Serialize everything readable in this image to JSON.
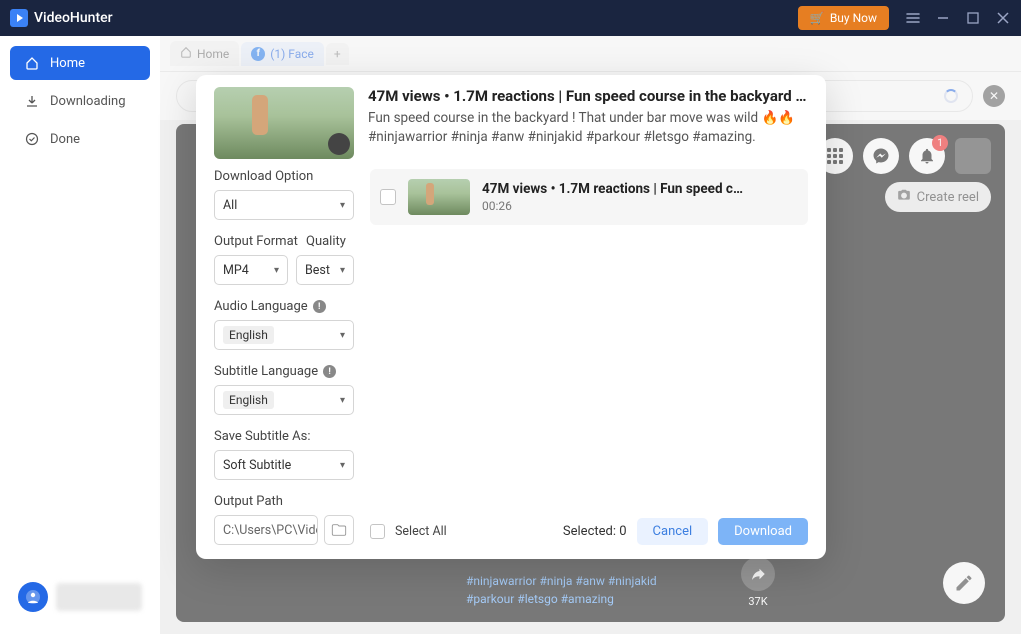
{
  "titlebar": {
    "app_name": "VideoHunter",
    "buy_label": "Buy Now"
  },
  "sidebar": {
    "items": [
      {
        "label": "Home"
      },
      {
        "label": "Downloading"
      },
      {
        "label": "Done"
      }
    ]
  },
  "tabs": {
    "home_label": "Home",
    "fb_label": "(1) Face"
  },
  "fb": {
    "create_reel": "Create reel",
    "notif_badge": "1",
    "share_count": "37K",
    "caption_line1_tags": "#ninjawarrior #ninja #anw #ninjakid",
    "caption_line2_tags": "#parkour #letsgo #amazing"
  },
  "modal": {
    "title": "47M views • 1.7M reactions | Fun speed course in the backyard ! T…",
    "description": "Fun speed course in the backyard ! That under bar move was wild 🔥🔥 #ninjawarrior #ninja #anw #ninjakid #parkour #letsgo #amazing.",
    "options": {
      "download_option_label": "Download Option",
      "download_option_value": "All",
      "output_format_label": "Output Format",
      "output_format_value": "MP4",
      "quality_label": "Quality",
      "quality_value": "Best",
      "audio_lang_label": "Audio Language",
      "audio_lang_value": "English",
      "subtitle_lang_label": "Subtitle Language",
      "subtitle_lang_value": "English",
      "save_subtitle_label": "Save Subtitle As:",
      "save_subtitle_value": "Soft Subtitle",
      "output_path_label": "Output Path",
      "output_path_value": "C:\\Users\\PC\\Vide"
    },
    "list": {
      "item_title": "47M views • 1.7M reactions | Fun speed c…",
      "item_duration": "00:26"
    },
    "footer": {
      "select_all": "Select All",
      "selected_label": "Selected: 0",
      "cancel": "Cancel",
      "download": "Download"
    }
  }
}
